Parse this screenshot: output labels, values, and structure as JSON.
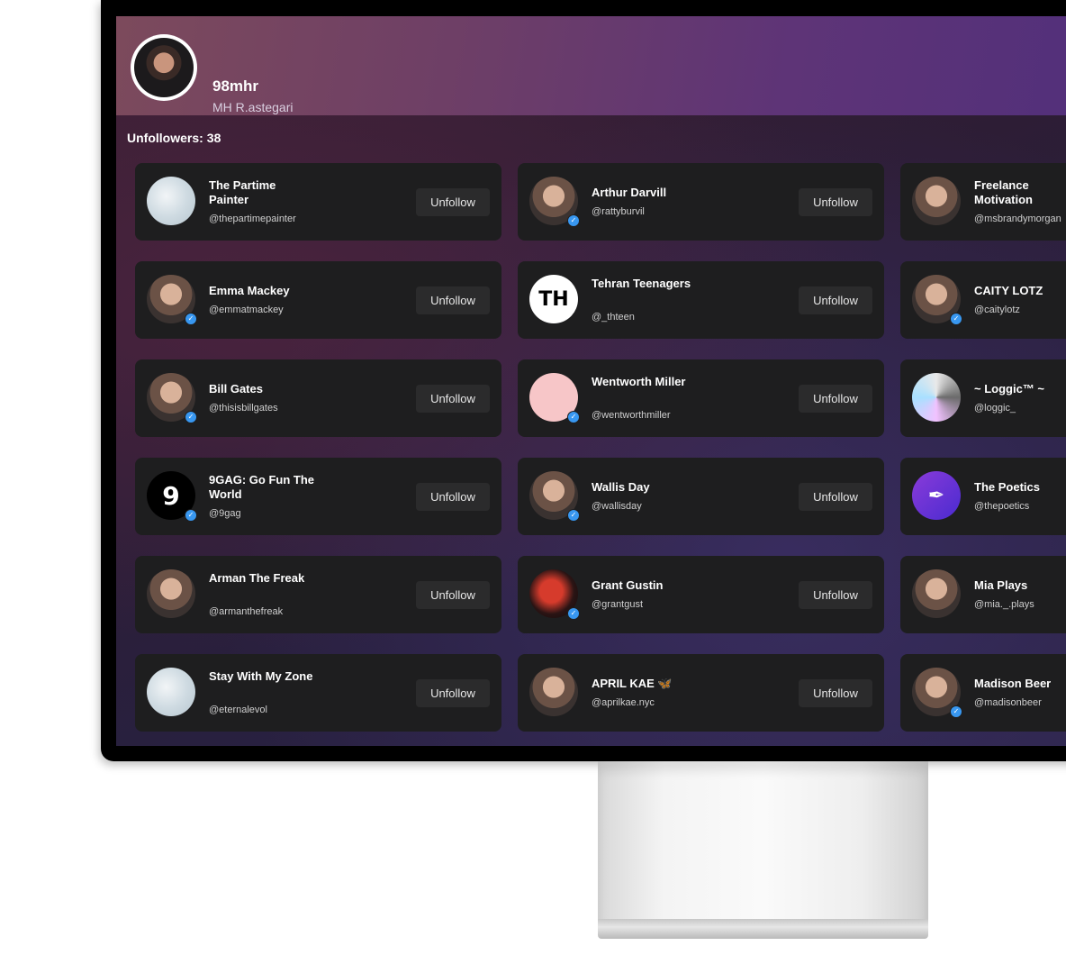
{
  "profile": {
    "username": "98mhr",
    "full_name": "MH R.astegari"
  },
  "stats": {
    "label": "Unfollowers:",
    "count": "38"
  },
  "button_label": "Unfollow",
  "users": [
    {
      "name": "The Partime Painter",
      "handle": "@thepartimepainter",
      "verified": false,
      "avatar": "marble-icon"
    },
    {
      "name": "Arthur Darvill",
      "handle": "@rattyburvil",
      "verified": true,
      "avatar": "person-icon"
    },
    {
      "name": "Freelance Motivation",
      "handle": "@msbrandymorgan",
      "verified": false,
      "avatar": "person-icon"
    },
    {
      "name": "Emma Mackey",
      "handle": "@emmatmackey",
      "verified": true,
      "avatar": "person-icon"
    },
    {
      "name": "Tehran Teenagers",
      "handle": "@_thteen",
      "verified": false,
      "avatar": "th-logo-icon"
    },
    {
      "name": "CAITY LOTZ",
      "handle": "@caitylotz",
      "verified": true,
      "avatar": "person-icon"
    },
    {
      "name": "Bill Gates",
      "handle": "@thisisbillgates",
      "verified": true,
      "avatar": "person-icon"
    },
    {
      "name": "Wentworth Miller",
      "handle": "@wentworthmiller",
      "verified": true,
      "avatar": "pink-circle-icon"
    },
    {
      "name": "~ Loggic™ ~",
      "handle": "@loggic_",
      "verified": false,
      "avatar": "art-icon"
    },
    {
      "name": "9GAG: Go Fun The World",
      "handle": "@9gag",
      "verified": true,
      "avatar": "9gag-logo-icon"
    },
    {
      "name": "Wallis Day",
      "handle": "@wallisday",
      "verified": true,
      "avatar": "person-icon"
    },
    {
      "name": "The Poetics",
      "handle": "@thepoetics",
      "verified": false,
      "avatar": "feather-logo-icon"
    },
    {
      "name": "Arman The Freak",
      "handle": "@armanthefreak",
      "verified": false,
      "avatar": "person-icon"
    },
    {
      "name": "Grant Gustin",
      "handle": "@grantgust",
      "verified": true,
      "avatar": "dancer-icon"
    },
    {
      "name": "Mia Plays",
      "handle": "@mia._.plays",
      "verified": false,
      "avatar": "person-icon"
    },
    {
      "name": "Stay With My Zone",
      "handle": "@eternalevol",
      "verified": false,
      "avatar": "marble-icon"
    },
    {
      "name": "APRIL KAE 🦋",
      "handle": "@aprilkae.nyc",
      "verified": false,
      "avatar": "person-icon"
    },
    {
      "name": "Madison Beer",
      "handle": "@madisonbeer",
      "verified": true,
      "avatar": "person-icon"
    }
  ]
}
